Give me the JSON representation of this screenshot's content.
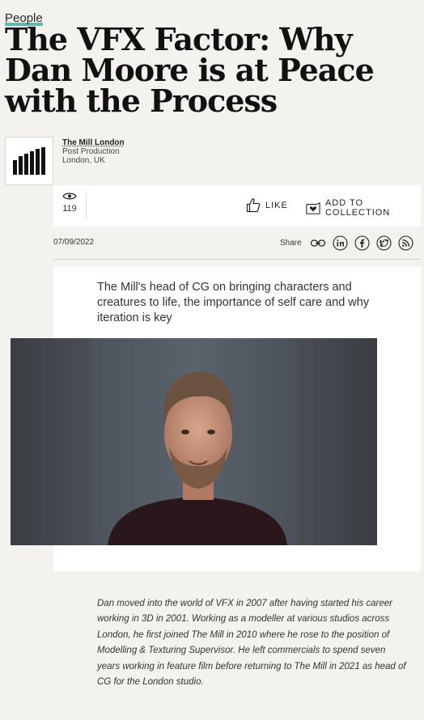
{
  "article": {
    "category": "People",
    "title": "The VFX Factor: Why Dan Moore is at Peace with the Process",
    "lede": "The Mill's head of CG on bringing characters and creatures to life, the importance of self care and why iteration is key",
    "caption": "Dan moved into the world of VFX in 2007 after having started his career working in 3D in 2001. Working as a modeller at various studios across London, he first joined The Mill in 2010 where he rose to the position of Modelling & Texturing Supervisor. He left commercials to spend seven years working in feature film before returning to The Mill in 2021 as head of CG for the London studio.",
    "date": "07/09/2022"
  },
  "company": {
    "name": "The Mill London",
    "type": "Post Production",
    "location": "London, UK",
    "logo_icon": "the-mill-logo"
  },
  "stats": {
    "views": "119",
    "views_icon": "eye-icon",
    "like_label": "LIKE",
    "like_icon": "thumbs-up-icon",
    "collection_label": "ADD TO COLLECTION",
    "collection_icon": "heart-box-icon"
  },
  "share": {
    "label": "Share",
    "icons": [
      "link-icon",
      "linkedin-icon",
      "facebook-icon",
      "twitter-icon",
      "rss-icon"
    ]
  },
  "colors": {
    "background": "#f3f2ee",
    "category_underline": "#5fb8b0",
    "card": "#ffffff"
  }
}
